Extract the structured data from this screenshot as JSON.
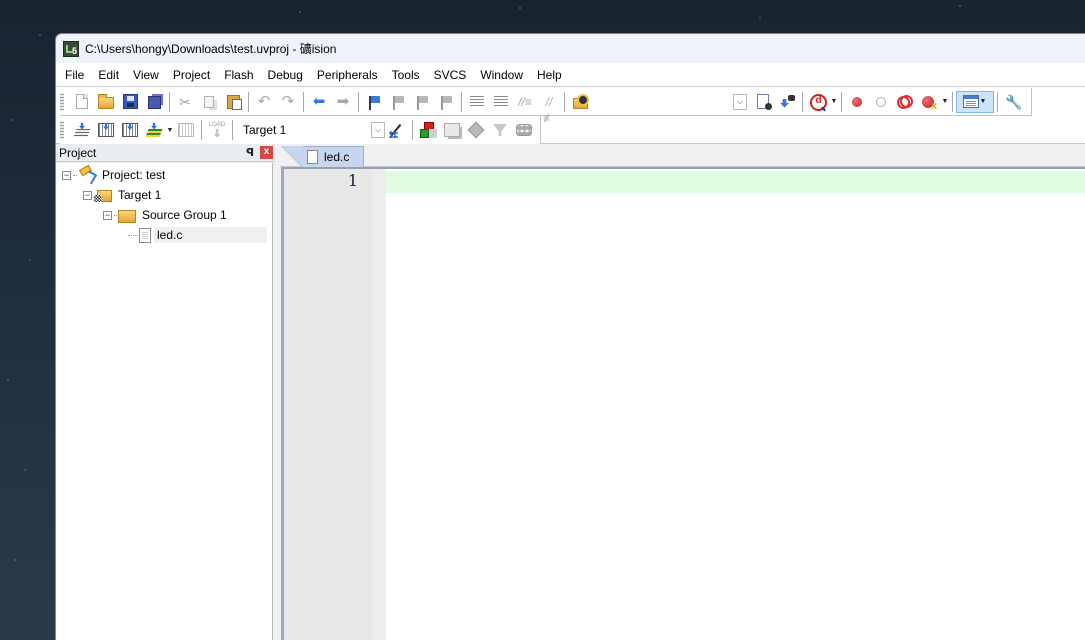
{
  "window": {
    "title": "C:\\Users\\hongy\\Downloads\\test.uvproj - 礦ision",
    "app_icon": "uvision-logo-icon"
  },
  "menu": {
    "items": [
      "File",
      "Edit",
      "View",
      "Project",
      "Flash",
      "Debug",
      "Peripherals",
      "Tools",
      "SVCS",
      "Window",
      "Help"
    ]
  },
  "toolbar_file": {
    "buttons": [
      {
        "name": "new-file",
        "icon": "new-document-icon",
        "enabled": true
      },
      {
        "name": "open-file",
        "icon": "open-folder-icon",
        "enabled": true
      },
      {
        "name": "save",
        "icon": "save-icon",
        "enabled": true
      },
      {
        "name": "save-all",
        "icon": "save-all-icon",
        "enabled": true
      },
      {
        "name": "cut",
        "icon": "scissors-icon",
        "enabled": false
      },
      {
        "name": "copy",
        "icon": "copy-icon",
        "enabled": false
      },
      {
        "name": "paste",
        "icon": "paste-icon",
        "enabled": true
      },
      {
        "name": "undo",
        "icon": "undo-icon",
        "enabled": false
      },
      {
        "name": "redo",
        "icon": "redo-icon",
        "enabled": false
      },
      {
        "name": "navigate-back",
        "icon": "arrow-left-icon",
        "enabled": true
      },
      {
        "name": "navigate-forward",
        "icon": "arrow-right-icon",
        "enabled": false
      },
      {
        "name": "insert-bookmark",
        "icon": "bookmark-flag-icon",
        "enabled": true
      },
      {
        "name": "prev-bookmark",
        "icon": "prev-bookmark-icon",
        "enabled": false
      },
      {
        "name": "next-bookmark",
        "icon": "next-bookmark-icon",
        "enabled": false
      },
      {
        "name": "clear-bookmarks",
        "icon": "clear-bookmarks-icon",
        "enabled": false
      },
      {
        "name": "indent",
        "icon": "indent-icon",
        "enabled": true
      },
      {
        "name": "unindent",
        "icon": "unindent-icon",
        "enabled": true
      },
      {
        "name": "comment",
        "icon": "comment-icon",
        "enabled": true
      },
      {
        "name": "uncomment",
        "icon": "uncomment-icon",
        "enabled": true
      },
      {
        "name": "find-in-files",
        "icon": "find-in-files-icon",
        "enabled": true
      }
    ],
    "right_buttons": [
      {
        "name": "find",
        "icon": "find-icon"
      },
      {
        "name": "incremental-find",
        "icon": "binoculars-icon"
      },
      {
        "name": "debug-session",
        "icon": "debug-icon"
      },
      {
        "name": "insert-breakpoint",
        "icon": "breakpoint-icon"
      },
      {
        "name": "enable-breakpoint",
        "icon": "breakpoint-hollow-icon"
      },
      {
        "name": "disable-all-breakpoints",
        "icon": "breakpoints-disable-icon"
      },
      {
        "name": "kill-all-breakpoints",
        "icon": "breakpoints-kill-icon"
      },
      {
        "name": "window-select",
        "icon": "window-select-icon"
      },
      {
        "name": "configure",
        "icon": "wrench-icon"
      }
    ]
  },
  "toolbar_build": {
    "target": "Target 1",
    "load_label": "LOAD",
    "buttons": [
      {
        "name": "translate",
        "icon": "translate-icon"
      },
      {
        "name": "build",
        "icon": "build-icon"
      },
      {
        "name": "rebuild",
        "icon": "rebuild-icon"
      },
      {
        "name": "batch-build",
        "icon": "batch-build-icon"
      },
      {
        "name": "stop-build",
        "icon": "stop-build-icon"
      },
      {
        "name": "download",
        "icon": "load-icon"
      },
      {
        "name": "options-for-target",
        "icon": "magic-wand-icon"
      },
      {
        "name": "manage-components",
        "icon": "manage-components-icon"
      },
      {
        "name": "select-packs",
        "icon": "windows-icon"
      },
      {
        "name": "manage-rte",
        "icon": "diamond-icon"
      },
      {
        "name": "pack-installer",
        "icon": "funnel-icon"
      },
      {
        "name": "select-software-packs",
        "icon": "diamonds-icon"
      }
    ]
  },
  "project_panel": {
    "title": "Project",
    "tree": [
      {
        "label": "Project: test",
        "level": 0,
        "expanded": true,
        "icon": "project-icon"
      },
      {
        "label": "Target 1",
        "level": 1,
        "expanded": true,
        "icon": "target-folder-icon"
      },
      {
        "label": "Source Group 1",
        "level": 2,
        "expanded": true,
        "icon": "folder-icon"
      },
      {
        "label": "led.c",
        "level": 3,
        "icon": "file-icon",
        "selected": true
      }
    ]
  },
  "editor": {
    "tabs": [
      {
        "label": "led.c",
        "active": true
      }
    ],
    "lines": [
      {
        "number": "1",
        "text": ""
      }
    ],
    "current_line_color": "#e0fce0"
  }
}
